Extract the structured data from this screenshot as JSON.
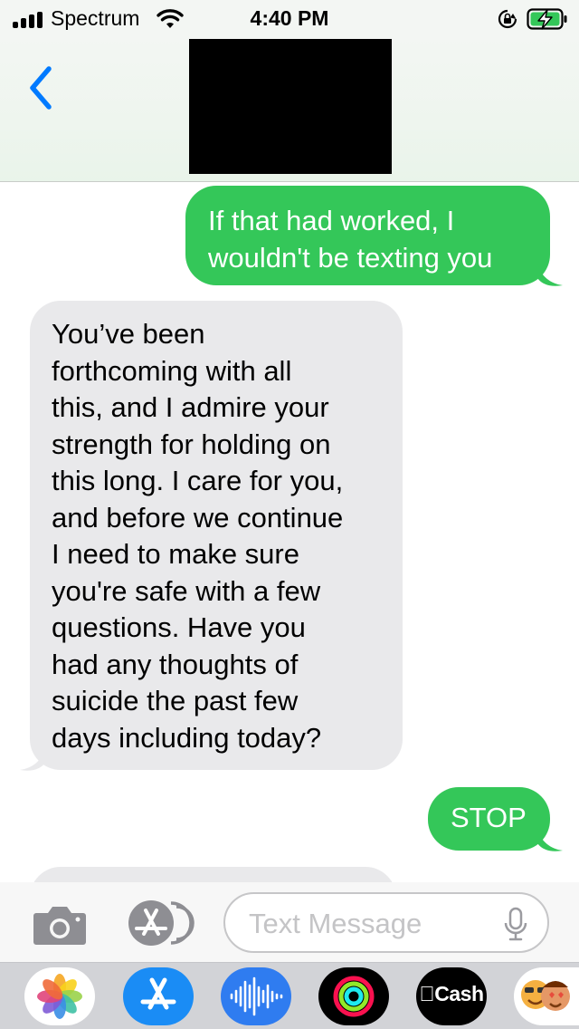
{
  "status_bar": {
    "carrier": "Spectrum",
    "time": "4:40 PM",
    "icons": [
      "signal-bars-icon",
      "wifi-icon",
      "orientation-lock-icon",
      "battery-charging-icon"
    ],
    "battery_color": "#34c759"
  },
  "nav": {
    "back_icon": "chevron-left-icon",
    "accent_color": "#007aff",
    "contact": "redacted"
  },
  "messages": [
    {
      "direction": "sent",
      "text": "If that had worked, I\nwouldn't be texting you"
    },
    {
      "direction": "received",
      "text": "You’ve been\nforthcoming with all\nthis, and I admire your\nstrength for holding on\nthis long.  I care for you,\nand before we continue\nI need to make sure\nyou're safe with a few\nquestions. Have you\nhad any thoughts of\nsuicide the past few\ndays including today?"
    },
    {
      "direction": "sent",
      "text": "STOP"
    }
  ],
  "colors": {
    "sent_bubble": "#34c759",
    "received_bubble": "#e9e9eb"
  },
  "composer": {
    "placeholder": "Text Message",
    "icons": [
      "camera-icon",
      "app-store-icon",
      "microphone-icon"
    ]
  },
  "app_drawer": {
    "apps": [
      {
        "name": "Photos",
        "icon": "photos-icon"
      },
      {
        "name": "App Store",
        "icon": "app-store-icon"
      },
      {
        "name": "Audio Message",
        "icon": "audio-waveform-icon"
      },
      {
        "name": "Fitness",
        "icon": "activity-rings-icon"
      },
      {
        "name": "Apple Cash",
        "icon": "apple-cash-icon",
        "label": "Cash"
      },
      {
        "name": "Memoji",
        "icon": "memoji-icon"
      }
    ]
  }
}
